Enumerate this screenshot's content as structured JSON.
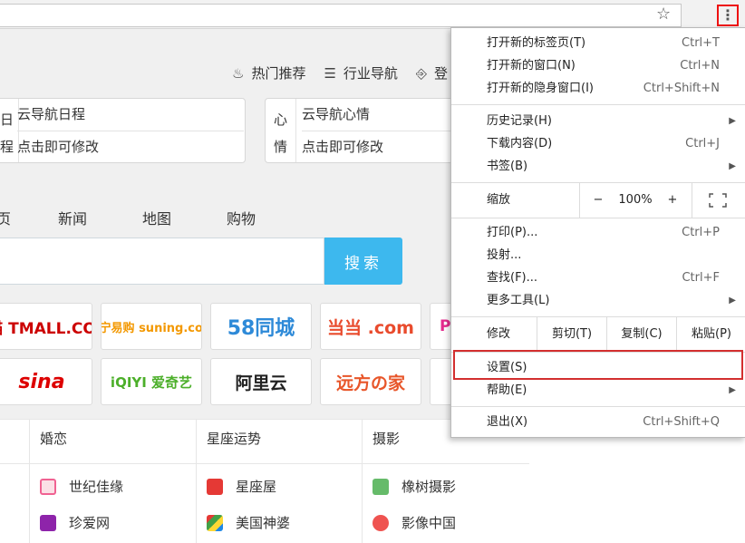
{
  "browser": {
    "star_icon": "star-icon",
    "menu_icon": "kebab-menu-icon"
  },
  "topnav": {
    "hot": "热门推荐",
    "industry": "行业导航",
    "login": "登"
  },
  "cards": {
    "left": {
      "side_top": "日",
      "side_bottom": "程",
      "title": "云导航日程",
      "hint": "点击即可修改"
    },
    "right": {
      "side_top": "心",
      "side_bottom": "情",
      "title": "云导航心情",
      "hint": "点击即可修改"
    }
  },
  "tabs": [
    "页",
    "新闻",
    "地图",
    "购物"
  ],
  "search": {
    "button": "搜索"
  },
  "logos": {
    "row1": [
      "天猫 TMALL.COM",
      "苏宁易购 suning.com",
      "58同城",
      "当当 .com",
      "P"
    ],
    "row2": [
      "sina",
      "iQIYI 爱奇艺",
      "阿里云",
      "远方の家",
      ""
    ]
  },
  "bottom": {
    "columns": [
      {
        "head": "婚恋",
        "items": [
          "世纪佳缘",
          "珍爱网"
        ]
      },
      {
        "head": "星座运势",
        "items": [
          "星座屋",
          "美国神婆"
        ]
      },
      {
        "head": "摄影",
        "items": [
          "橡树摄影",
          "影像中国"
        ]
      }
    ]
  },
  "menu": {
    "group1": [
      {
        "label": "打开新的标签页(T)",
        "shortcut": "Ctrl+T"
      },
      {
        "label": "打开新的窗口(N)",
        "shortcut": "Ctrl+N"
      },
      {
        "label": "打开新的隐身窗口(I)",
        "shortcut": "Ctrl+Shift+N"
      }
    ],
    "group2": [
      {
        "label": "历史记录(H)",
        "shortcut": ""
      },
      {
        "label": "下载内容(D)",
        "shortcut": "Ctrl+J"
      },
      {
        "label": "书签(B)",
        "shortcut": ""
      }
    ],
    "zoom": {
      "label": "缩放",
      "minus": "−",
      "value": "100%",
      "plus": "+",
      "fullscreen_icon": "fullscreen-icon"
    },
    "group3": [
      {
        "label": "打印(P)...",
        "shortcut": "Ctrl+P"
      },
      {
        "label": "投射...",
        "shortcut": ""
      },
      {
        "label": "查找(F)...",
        "shortcut": "Ctrl+F"
      },
      {
        "label": "更多工具(L)",
        "shortcut": ""
      }
    ],
    "edit": {
      "label": "修改",
      "cut": "剪切(T)",
      "copy": "复制(C)",
      "paste": "粘贴(P)"
    },
    "group4": [
      {
        "label": "设置(S)"
      },
      {
        "label": "帮助(E)"
      }
    ],
    "exit": {
      "label": "退出(X)",
      "shortcut": "Ctrl+Shift+Q"
    }
  }
}
